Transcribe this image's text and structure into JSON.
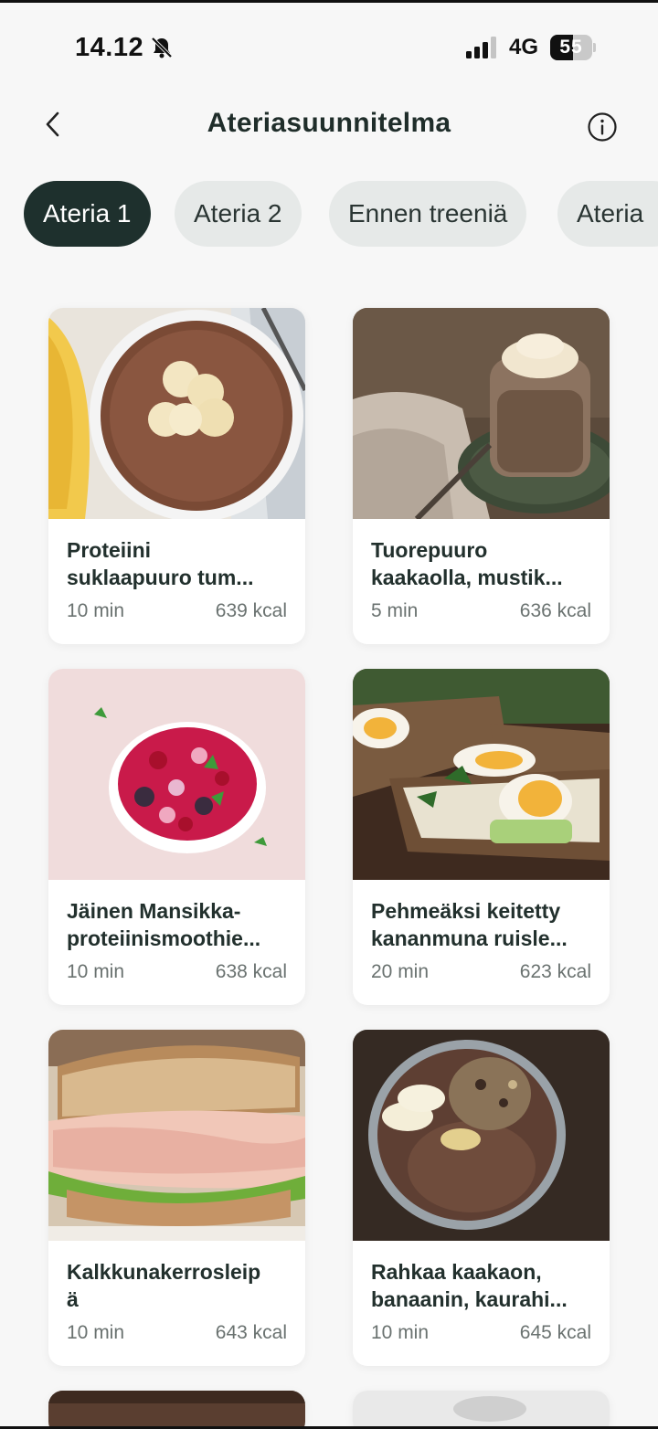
{
  "status_bar": {
    "time": "14.12",
    "network": "4G",
    "battery": "55",
    "battery_level": 0.55,
    "icons": [
      "bell-off-icon",
      "signal-icon",
      "battery-icon"
    ]
  },
  "header": {
    "title": "Ateriasuunnitelma",
    "back_icon": "chevron-left-icon",
    "info_icon": "info-icon"
  },
  "tabs": [
    {
      "label": "Ateria 1",
      "active": true
    },
    {
      "label": "Ateria 2",
      "active": false
    },
    {
      "label": "Ennen treeniä",
      "active": false
    },
    {
      "label": "Ateria",
      "active": false
    }
  ],
  "recipes": [
    {
      "title_line1": "Proteiini",
      "title_line2": "suklaapuuro tum...",
      "time": "10 min",
      "kcal": "639 kcal",
      "image": "chocolate-porridge-with-banana"
    },
    {
      "title_line1": "Tuorepuuro",
      "title_line2": "kaakaolla, mustik...",
      "time": "5 min",
      "kcal": "636 kcal",
      "image": "overnight-oats-jar"
    },
    {
      "title_line1": "Jäinen Mansikka-",
      "title_line2": "proteiinismoothie...",
      "time": "10 min",
      "kcal": "638 kcal",
      "image": "berry-smoothie-bowl"
    },
    {
      "title_line1": "Pehmeäksi keitetty",
      "title_line2": "kananmuna ruisle...",
      "time": "20 min",
      "kcal": "623 kcal",
      "image": "egg-rye-sandwiches"
    },
    {
      "title_line1": "Kalkkunakerrosleip",
      "title_line2": "ä",
      "time": "10 min",
      "kcal": "643 kcal",
      "image": "turkey-sandwich"
    },
    {
      "title_line1": "Rahkaa kaakaon,",
      "title_line2": "banaanin, kaurahi...",
      "time": "10 min",
      "kcal": "645 kcal",
      "image": "cocoa-quark-bowl"
    }
  ],
  "colors": {
    "background": "#f7f7f7",
    "active_tab": "#1e302d",
    "inactive_tab": "#e6e9e8",
    "title_text": "#22302d",
    "meta_text": "#6a7270"
  }
}
